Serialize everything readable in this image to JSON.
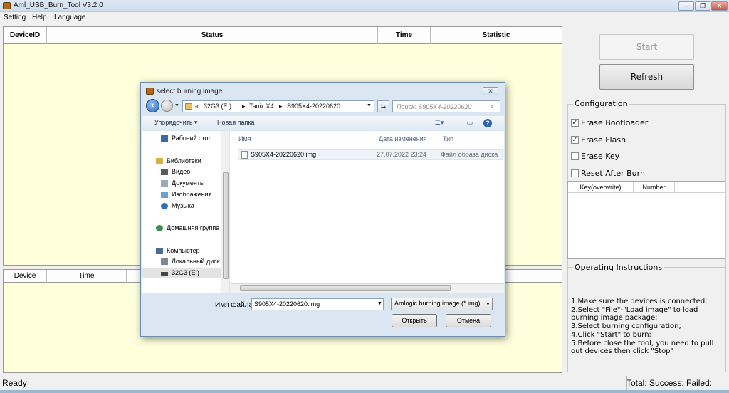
{
  "window": {
    "title": "Aml_USB_Burn_Tool V3.2.0",
    "min": "–",
    "max": "❐",
    "close": "✕"
  },
  "menu": [
    "Setting",
    "Help",
    "Language"
  ],
  "device_table": {
    "columns": [
      "DeviceID",
      "Status",
      "Time",
      "Statistic"
    ]
  },
  "log_table": {
    "columns": [
      "Device",
      "Time"
    ]
  },
  "buttons": {
    "start": "Start",
    "refresh": "Refresh"
  },
  "configuration": {
    "title": "Configuration",
    "options": [
      {
        "label": "Erase Bootloader",
        "checked": true
      },
      {
        "label": "Erase Flash",
        "checked": true
      },
      {
        "label": "Erase Key",
        "checked": false
      },
      {
        "label": "Reset After Burn",
        "checked": false
      }
    ],
    "key_table": {
      "columns": [
        "Key(overwrite)",
        "Number"
      ]
    }
  },
  "instructions": {
    "title": "Operating Instructions",
    "lines": [
      "1.Make sure the devices is connected;",
      "2.Select \"File\"-\"Load image\" to load burning image package;",
      "3.Select burning configuration;",
      "4.Click \"Start\" to burn;",
      "5.Before close the tool, you need to pull out devices then click \"Stop\""
    ]
  },
  "status": {
    "ready": "Ready",
    "counts": "Total:  Success:  Failed:"
  },
  "dialog": {
    "title": "select burning image",
    "close": "✕",
    "breadcrumb": [
      "«",
      "32G3 (E:)",
      "▸",
      "Tanix X4",
      "▸",
      "S905X4-20220620"
    ],
    "search_placeholder": "Поиск: S905X4-20220620",
    "toolbar": {
      "organize": "Упорядочить ▾",
      "new_folder": "Новая папка"
    },
    "nav": [
      {
        "label": "Рабочий стол",
        "icon": "desktop-icon",
        "color": "#3a6aa8"
      },
      {
        "label": "Библиотеки",
        "icon": "libraries-icon",
        "color": "#d7b04a"
      },
      {
        "label": "Видео",
        "icon": "video-icon",
        "color": "#5a5a5a"
      },
      {
        "label": "Документы",
        "icon": "documents-icon",
        "color": "#9aa9bb"
      },
      {
        "label": "Изображения",
        "icon": "pictures-icon",
        "color": "#6f9fd0"
      },
      {
        "label": "Музыка",
        "icon": "music-icon",
        "color": "#2e6fb5"
      },
      {
        "label": "Домашняя группа",
        "icon": "homegroup-icon",
        "color": "#3b8f4f"
      },
      {
        "label": "Компьютер",
        "icon": "computer-icon",
        "color": "#4c6e96"
      },
      {
        "label": "Локальный диск",
        "icon": "local-disk-icon",
        "color": "#7b8796"
      },
      {
        "label": "32G3 (E:)",
        "icon": "usb-drive-icon",
        "color": "#444444"
      }
    ],
    "columns": {
      "name": "Имя",
      "date": "Дата изменения",
      "type": "Тип"
    },
    "file": {
      "name": "S905X4-20220620.img",
      "date": "27.07.2022 23:24",
      "type": "Файл образа диска"
    },
    "filename_label": "Имя файла:",
    "filename_value": "S905X4-20220620.img",
    "filetype": "Amlogic burning image (*.img)",
    "open": "Открыть",
    "cancel": "Отмена"
  }
}
